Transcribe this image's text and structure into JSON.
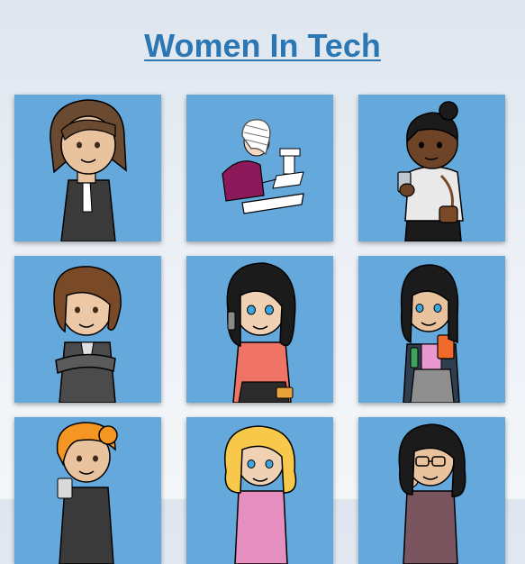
{
  "header": {
    "title": "Women In Tech"
  },
  "gallery": {
    "items": [
      {
        "icon": "woman-dark-suit-icon",
        "palette": {
          "hair": "#6b4a32",
          "skin": "#e9c29e",
          "outfit": "#3a3a3a"
        }
      },
      {
        "icon": "woman-at-desk-sketch-icon",
        "palette": {
          "hair": "#bdbdbd",
          "skin": "#f3d9c3",
          "outfit": "#8c1a5a"
        }
      },
      {
        "icon": "woman-with-phone-icon",
        "palette": {
          "hair": "#1b1b1b",
          "skin": "#6e4428",
          "outfit": "#e9e9e9"
        }
      },
      {
        "icon": "woman-arms-crossed-icon",
        "palette": {
          "hair": "#7a4a28",
          "skin": "#ecc8a6",
          "outfit": "#4b4b4b"
        }
      },
      {
        "icon": "woman-on-call-icon",
        "palette": {
          "hair": "#1b1b1b",
          "skin": "#f0d1b4",
          "outfit": "#f07466"
        }
      },
      {
        "icon": "woman-with-folder-icon",
        "palette": {
          "hair": "#1b1b1b",
          "skin": "#e9c29e",
          "outfit": "#2f3e4e"
        }
      },
      {
        "icon": "woman-orange-hair-icon",
        "palette": {
          "hair": "#f59623",
          "skin": "#e9c29e",
          "outfit": "#3a3a3a"
        }
      },
      {
        "icon": "woman-blonde-hair-icon",
        "palette": {
          "hair": "#f7c84a",
          "skin": "#f0d1b4",
          "outfit": "#e58ec0"
        }
      },
      {
        "icon": "woman-with-glasses-icon",
        "palette": {
          "hair": "#1b1b1b",
          "skin": "#e9c29e",
          "outfit": "#7a5560"
        }
      }
    ]
  }
}
